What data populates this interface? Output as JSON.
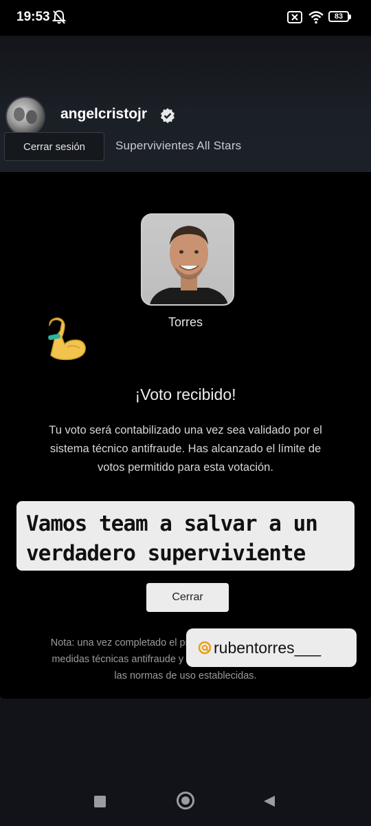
{
  "status_bar": {
    "time": "19:53",
    "battery": "83",
    "icons": [
      "bell-off-icon",
      "sim-x-icon",
      "wifi-icon",
      "battery-icon"
    ]
  },
  "header": {
    "username": "angelcristojr",
    "verified_icon": "verified-badge-icon",
    "logout_label": "Cerrar sesión",
    "program": "Supervivientes All Stars"
  },
  "candidate": {
    "name": "Torres"
  },
  "stickers": {
    "emoji": "flexed-biceps-emoji",
    "text_lines": [
      "Vamos team a salvar a un",
      "verdadero superviviente"
    ],
    "handle": "rubentorres___",
    "handle_icon": "threads-icon"
  },
  "confirmation": {
    "title": "¡Voto recibido!",
    "message": "Tu voto será contabilizado una vez sea validado por el sistema técnico antifraude. Has alcanzado el límite de votos permitido para esta votación.",
    "close_label": "Cerrar",
    "note": "Nota: una vez completado el proceso de votación, pasará las medidas técnicas antifraude y se contabilizará si cumple con las normas de uso establecidas."
  },
  "navigation": {
    "buttons": [
      "recents-icon",
      "home-icon",
      "back-icon"
    ]
  },
  "colors": {
    "background": "#111318",
    "card": "#000000",
    "button": "#ececec",
    "text": "#ffffff"
  }
}
